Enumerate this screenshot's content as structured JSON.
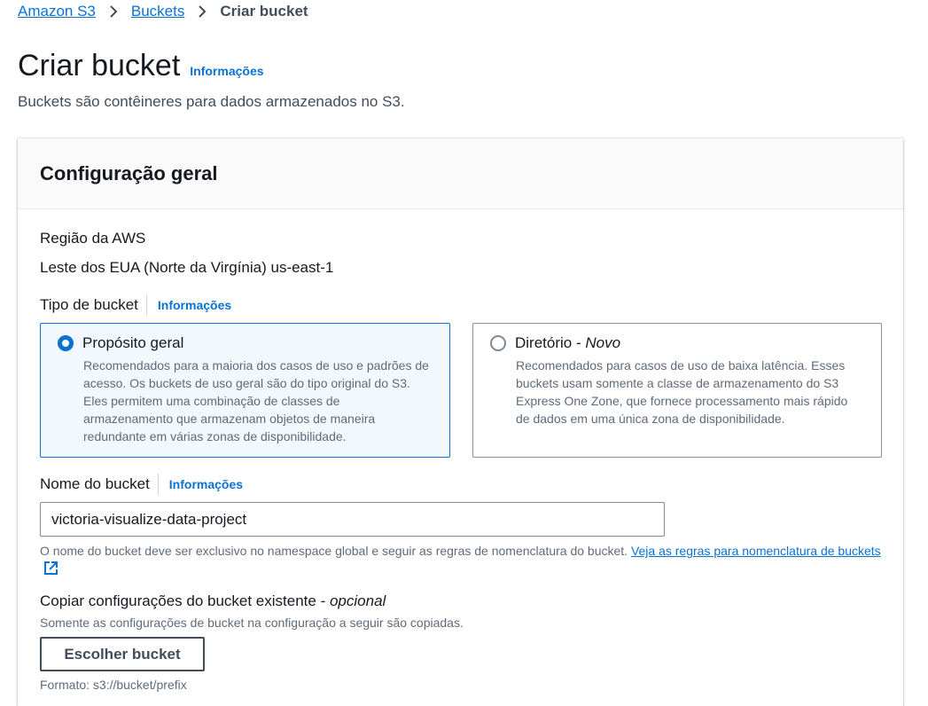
{
  "breadcrumb": {
    "items": [
      "Amazon S3",
      "Buckets"
    ],
    "current": "Criar bucket"
  },
  "page": {
    "title": "Criar bucket",
    "info_link": "Informações",
    "description": "Buckets são contêineres para dados armazenados no S3."
  },
  "general_config": {
    "title": "Configuração geral",
    "region_label": "Região da AWS",
    "region_value": "Leste dos EUA (Norte da Virgínia) us-east-1",
    "bucket_type": {
      "label": "Tipo de bucket",
      "info_link": "Informações",
      "options": [
        {
          "title": "Propósito geral",
          "selected": true,
          "description": "Recomendados para a maioria dos casos de uso e padrões de acesso. Os buckets de uso geral são do tipo original do S3. Eles permitem uma combinação de classes de armazenamento que armazenam objetos de maneira redundante em várias zonas de disponibilidade."
        },
        {
          "title": "Diretório",
          "title_separator": " - ",
          "badge": "Novo",
          "selected": false,
          "description": "Recomendados para casos de uso de baixa latência. Esses buckets usam somente a classe de armazenamento do S3 Express One Zone, que fornece processamento mais rápido de dados em uma única zona de disponibilidade."
        }
      ]
    },
    "bucket_name": {
      "label": "Nome do bucket",
      "info_link": "Informações",
      "value": "victoria-visualize-data-project",
      "help_text": "O nome do bucket deve ser exclusivo no namespace global e seguir as regras de nomenclatura do bucket.",
      "help_link": "Veja as regras para nomenclatura de buckets"
    },
    "copy_settings": {
      "label": "Copiar configurações do bucket existente",
      "label_separator": " - ",
      "optional": "opcional",
      "description": "Somente as configurações de bucket na configuração a seguir são copiadas.",
      "button": "Escolher bucket",
      "format_hint": "Formato: s3://bucket/prefix"
    }
  },
  "colors": {
    "link": "#0972d3",
    "selected_border": "#0972d3",
    "selected_bg": "#f2f8fd",
    "text": "#16191f",
    "secondary_text": "#5f6b7a"
  }
}
